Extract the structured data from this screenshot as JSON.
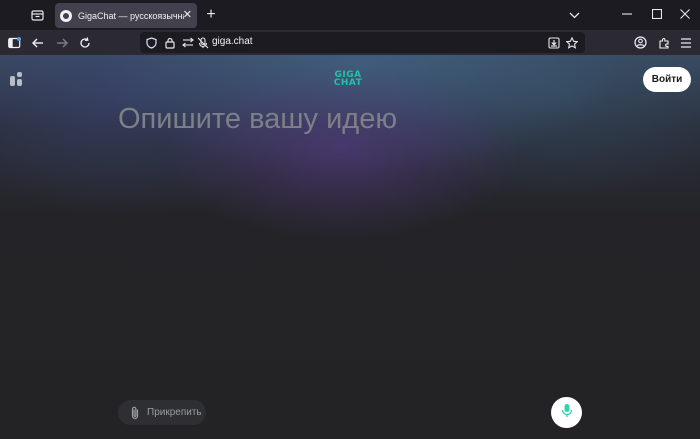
{
  "browser": {
    "tab": {
      "title": "GigaChat — русскоязычная нейр",
      "close": "✕"
    },
    "new_tab": "+",
    "list_all_tabs": "⌄",
    "window": {
      "minimize": "—",
      "maximize": "☐",
      "close": "✕"
    },
    "url": "giga.chat"
  },
  "page": {
    "logo_top": "GIGA",
    "logo_bottom": "CHAT",
    "login_label": "Войти",
    "prompt_placeholder": "Опишите вашу идею",
    "attach_label": "Прикрепить",
    "accent_color": "#22c3a6"
  }
}
